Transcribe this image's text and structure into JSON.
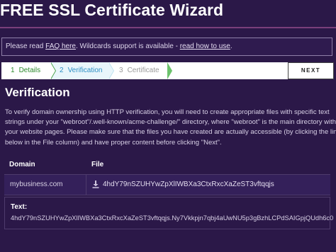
{
  "header": {
    "title": "FREE SSL Certificate Wizard"
  },
  "notice": {
    "prefix": "Please read ",
    "faq_link": "FAQ here",
    "middle": ". Wildcards support is available - ",
    "howto_link": "read how to use",
    "suffix": "."
  },
  "steps": [
    {
      "number": "1",
      "label": "Details",
      "state": "done"
    },
    {
      "number": "2",
      "label": "Verification",
      "state": "active"
    },
    {
      "number": "3",
      "label": "Certificate",
      "state": "pending"
    }
  ],
  "next_button": "NEXT",
  "section": {
    "title": "Verification",
    "description_lines": [
      "To verify domain ownership using HTTP verification, you will need to create appropriate files with specific text",
      "strings under your \"webroot\"/.well-known/acme-challenge/\" directory, where \"webroot\" is the main directory with",
      "your website pages. Please make sure that the files you have created are actually accessible (by clicking the links",
      "below in the File column) and have proper content before clicking \"Next\"."
    ]
  },
  "table": {
    "headers": [
      "Domain",
      "File"
    ],
    "rows": [
      {
        "domain": "mybusiness.com",
        "file": "4hdY79nSZUHYwZpXlIWBXa3CtxRxcXaZeST3vftqqjs"
      }
    ]
  },
  "text_field": {
    "label": "Text:",
    "value": "4hdY79nSZUHYwZpXlIWBXa3CtxRxcXaZeST3vftqqjs.Ny7Vkkpjn7qbj4aUwNU5p3gBzhLCPdSAIGpjQUdh6c0"
  },
  "colors": {
    "background": "#2b1848",
    "accent_rule": "#7a3f7a",
    "step_done": "#2e8b2e",
    "step_active": "#2c8fc4",
    "step_pending": "#9a9a9a"
  },
  "icons": {
    "file_download": "download-icon"
  }
}
